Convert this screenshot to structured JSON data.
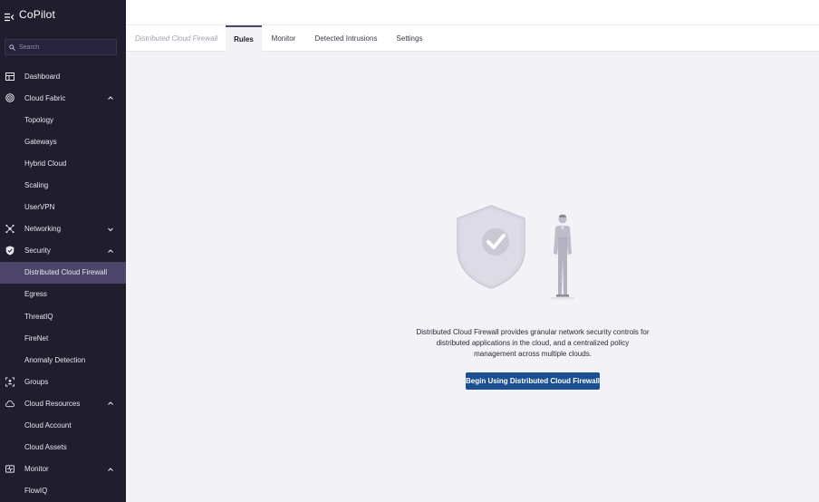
{
  "app": {
    "title": "CoPilot"
  },
  "search": {
    "placeholder": "Search"
  },
  "sidebar": {
    "items": [
      {
        "label": "Dashboard",
        "icon": "dashboard-icon",
        "type": "top"
      },
      {
        "label": "Cloud Fabric",
        "icon": "target-icon",
        "type": "top",
        "chevron": "up"
      },
      {
        "label": "Topology",
        "type": "sub"
      },
      {
        "label": "Gateways",
        "type": "sub"
      },
      {
        "label": "Hybrid Cloud",
        "type": "sub"
      },
      {
        "label": "Scaling",
        "type": "sub"
      },
      {
        "label": "UserVPN",
        "type": "sub"
      },
      {
        "label": "Networking",
        "icon": "network-icon",
        "type": "top",
        "chevron": "down"
      },
      {
        "label": "Security",
        "icon": "shield-icon",
        "type": "top",
        "chevron": "up"
      },
      {
        "label": "Distributed Cloud Firewall",
        "type": "sub",
        "active": true
      },
      {
        "label": "Egress",
        "type": "sub"
      },
      {
        "label": "ThreatIQ",
        "type": "sub"
      },
      {
        "label": "FireNet",
        "type": "sub"
      },
      {
        "label": "Anomaly Detection",
        "type": "sub"
      },
      {
        "label": "Groups",
        "icon": "groups-icon",
        "type": "top"
      },
      {
        "label": "Cloud Resources",
        "icon": "cloud-icon",
        "type": "top",
        "chevron": "up"
      },
      {
        "label": "Cloud Account",
        "type": "sub"
      },
      {
        "label": "Cloud Assets",
        "type": "sub"
      },
      {
        "label": "Monitor",
        "icon": "monitor-icon",
        "type": "top",
        "chevron": "up"
      },
      {
        "label": "FlowIQ",
        "type": "sub"
      }
    ]
  },
  "breadcrumb": "Distributed Cloud Firewall",
  "tabs": [
    {
      "label": "Rules",
      "active": true
    },
    {
      "label": "Monitor"
    },
    {
      "label": "Detected Intrusions"
    },
    {
      "label": "Settings"
    }
  ],
  "main": {
    "description": "Distributed Cloud Firewall provides granular network security controls for distributed applications in the cloud, and a centralized policy management across multiple clouds.",
    "cta_label": "Begin Using Distributed Cloud Firewall"
  },
  "colors": {
    "sidebar_bg": "#201d2e",
    "active_item_bg": "#4d4569",
    "primary_button": "#1b4f91",
    "content_bg": "#f2f2f7"
  }
}
